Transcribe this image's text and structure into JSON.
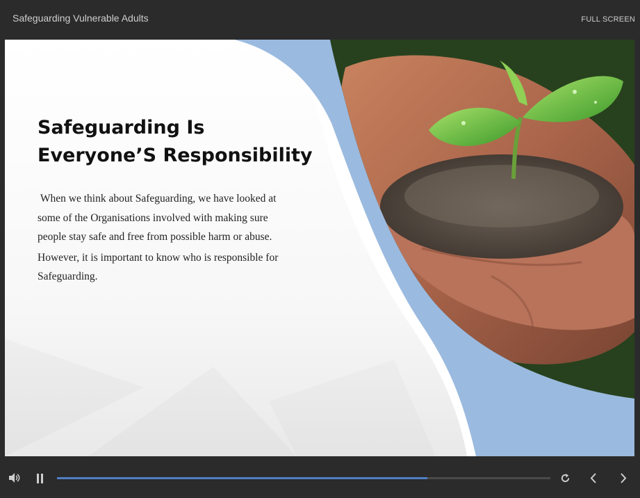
{
  "header": {
    "course_title": "Safeguarding Vulnerable Adults",
    "fullscreen_label": "FULL SCREEN"
  },
  "slide": {
    "heading_line1": "Safeguarding Is",
    "heading_line2": "Everyone’S Responsibility",
    "paragraph1": " When we think about Safeguarding, we have looked at some of the Organisations involved with making sure people stay safe and free from possible harm or abuse.",
    "paragraph2": "However, it is important to know who is responsible for Safeguarding.",
    "image": "hands-holding-soil-with-seedling",
    "accent_color": "#9bbadf"
  },
  "player": {
    "progress_fraction": 0.75,
    "progress_color": "#4f7fc4",
    "icons": [
      "volume-icon",
      "pause-icon",
      "replay-icon",
      "prev-icon",
      "next-icon"
    ]
  }
}
